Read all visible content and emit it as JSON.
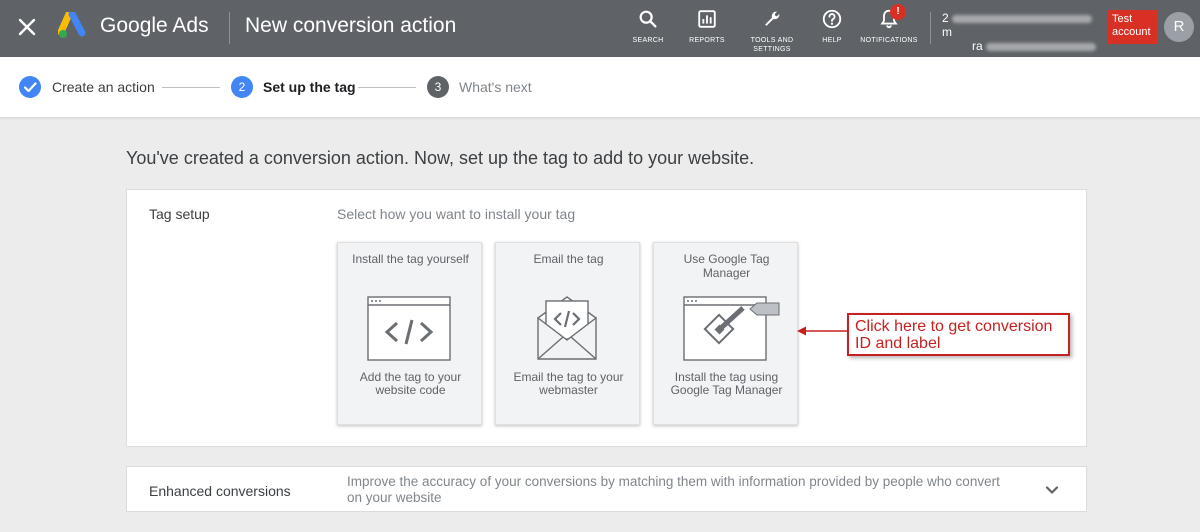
{
  "header": {
    "brand": "Google Ads",
    "page_title": "New conversion action",
    "nav": {
      "search": "SEARCH",
      "reports": "REPORTS",
      "tools_line1": "TOOLS AND",
      "tools_line2": "SETTINGS",
      "help": "HELP",
      "notifications": "NOTIFICATIONS"
    },
    "notification_badge": "!",
    "account_line1_prefix": "2",
    "account_line1_suffix": "m",
    "account_line2_prefix": "ra",
    "test_account": "Test account",
    "avatar_initial": "R"
  },
  "stepper": {
    "steps": [
      {
        "label": "Create an action",
        "state": "done"
      },
      {
        "number": "2",
        "label": "Set up the tag",
        "state": "current"
      },
      {
        "number": "3",
        "label": "What's next",
        "state": "pending"
      }
    ]
  },
  "main": {
    "headline": "You've created a conversion action. Now, set up the tag to add to your website.",
    "tag_setup": {
      "title": "Tag setup",
      "subtitle": "Select how you want to install your tag",
      "options": [
        {
          "title": "Install the tag yourself",
          "description": "Add the tag to your website code",
          "icon": "code-window-icon"
        },
        {
          "title": "Email the tag",
          "description": "Email the tag to your webmaster",
          "icon": "email-code-icon"
        },
        {
          "title": "Use Google Tag Manager",
          "description": "Install the tag using Google Tag Manager",
          "icon": "tag-manager-icon"
        }
      ]
    },
    "annotation": "Click here to get conversion ID and label",
    "enhanced_conversions": {
      "title": "Enhanced conversions",
      "description": "Improve the accuracy of your conversions by matching them with information provided by people who convert on your website"
    }
  },
  "colors": {
    "header_bg": "#5f6368",
    "accent_blue": "#4285f4",
    "alert_red": "#d93025",
    "annotation_red": "#c5221f"
  }
}
